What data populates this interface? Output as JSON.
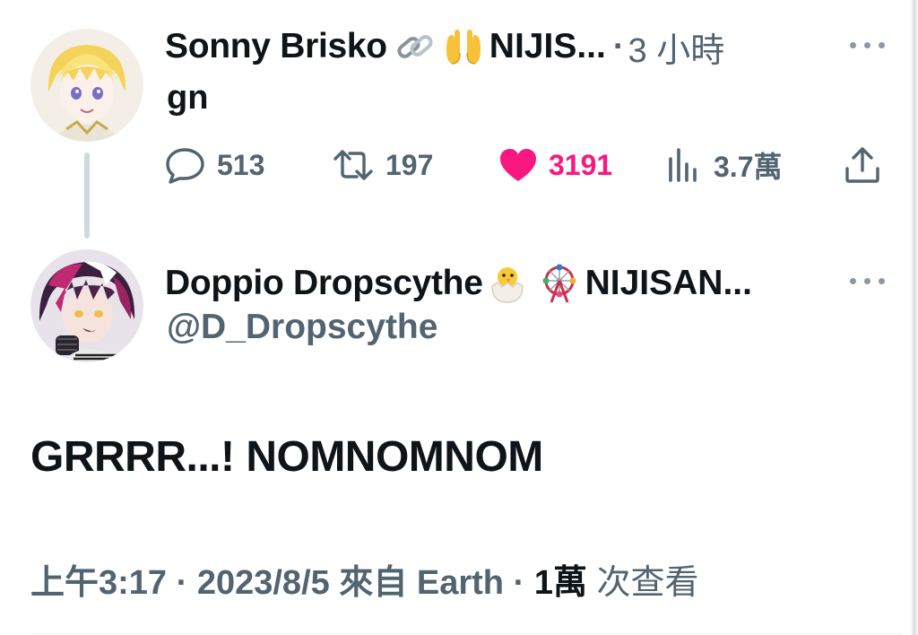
{
  "reply_tweet": {
    "author": {
      "display_name": "Sonny Brisko",
      "name_suffix": "NIJIS...",
      "emojis": [
        "link-emoji",
        "palms-up-emoji"
      ],
      "avatar": "avatar-sonny"
    },
    "separator": "·",
    "time": "3 小時",
    "text": "gn",
    "actions": {
      "replies": "513",
      "retweets": "197",
      "likes": "3191",
      "views": "3.7萬"
    },
    "icons": {
      "reply": "reply-icon",
      "retweet": "retweet-icon",
      "like": "heart-icon",
      "views": "views-icon",
      "share": "share-icon",
      "more": "more-icon"
    }
  },
  "main_tweet": {
    "author": {
      "display_name": "Doppio Dropscythe",
      "name_suffix": "NIJISAN...",
      "handle": "@D_Dropscythe",
      "emojis": [
        "hatching-chick-emoji",
        "ferris-wheel-emoji"
      ],
      "avatar": "avatar-doppio"
    },
    "text": "GRRRR...! NOMNOMNOM",
    "meta": {
      "time": "上午3:17",
      "sep1": "·",
      "date": "2023/8/5",
      "source": "來自 Earth",
      "sep2": "·",
      "views_count": "1萬",
      "views_label": "次查看"
    }
  },
  "colors": {
    "text_primary": "#0f1419",
    "text_secondary": "#536471",
    "like_active": "#f91880",
    "thread_line": "#cfd9de"
  }
}
